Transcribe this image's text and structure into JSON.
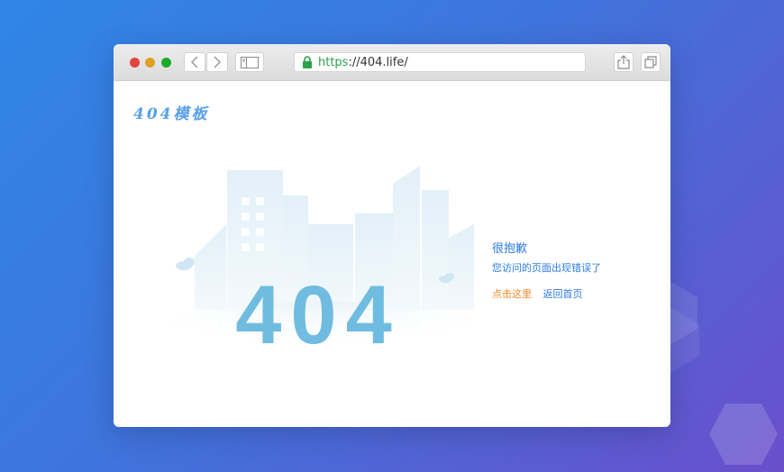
{
  "browser": {
    "url_scheme": "https",
    "url_rest": "://404.life/"
  },
  "page": {
    "logo_text": "404模板",
    "big_code": "404",
    "title": "很抱歉",
    "subtitle": "您访问的页面出现错误了",
    "link_click_here": "点击这里",
    "link_home": "返回首页"
  },
  "colors": {
    "accent_blue": "#2c7be5",
    "accent_orange": "#f08a24",
    "code_blue": "#6fbce0"
  }
}
